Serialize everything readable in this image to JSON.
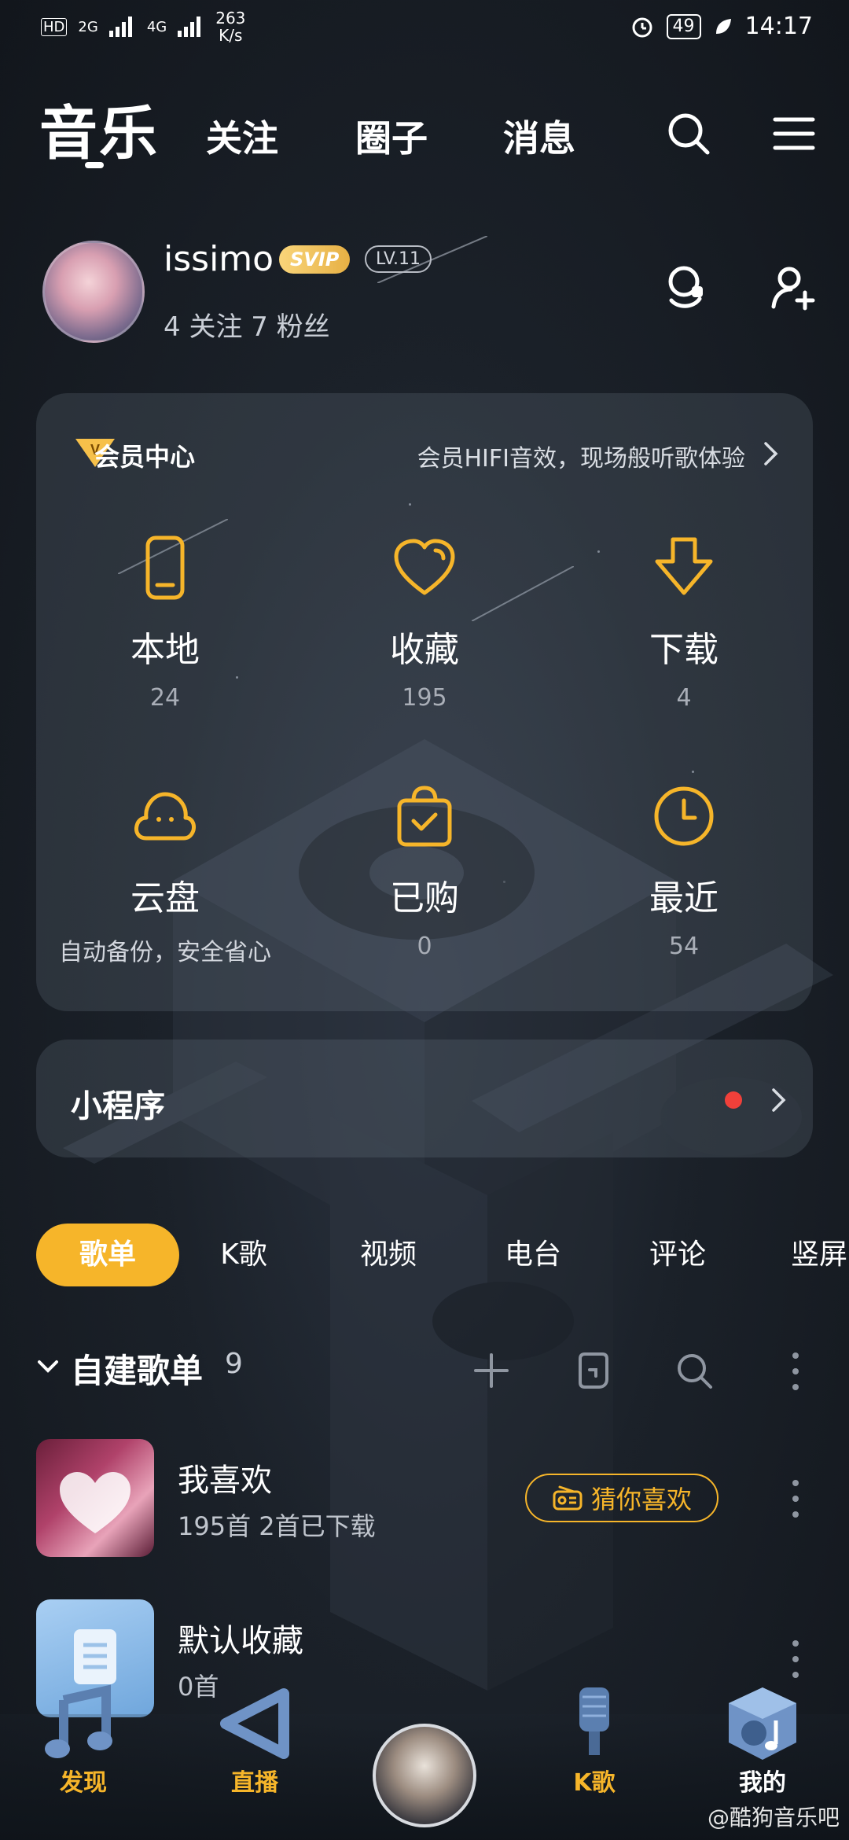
{
  "status_bar": {
    "network_badge": "HD",
    "signal_1": "2G",
    "signal_2": "4G",
    "speed_value": "263",
    "speed_unit": "K/s",
    "battery": "49",
    "time": "14:17"
  },
  "top_nav": {
    "brand": "音乐",
    "tabs": [
      "关注",
      "圈子",
      "消息"
    ]
  },
  "profile": {
    "username": "issimo",
    "svip_badge": "SVIP",
    "level_badge": "LV.11",
    "follow_stats": "4 关注   7 粉丝"
  },
  "vip_card": {
    "title": "会员中心",
    "description": "会员HIFI音效，现场般听歌体验",
    "items": [
      {
        "label": "本地",
        "count": "24",
        "icon": "phone-icon"
      },
      {
        "label": "收藏",
        "count": "195",
        "icon": "heart-icon"
      },
      {
        "label": "下载",
        "count": "4",
        "icon": "download-icon"
      },
      {
        "label": "云盘",
        "count": "自动备份，安全省心",
        "icon": "cloud-icon"
      },
      {
        "label": "已购",
        "count": "0",
        "icon": "shopping-bag-icon"
      },
      {
        "label": "最近",
        "count": "54",
        "icon": "clock-icon"
      }
    ]
  },
  "mini_program": {
    "title": "小程序"
  },
  "content_tabs": [
    "歌单",
    "K歌",
    "视频",
    "电台",
    "评论",
    "竖屏"
  ],
  "playlist_section": {
    "title": "自建歌单",
    "count": "9",
    "playlists": [
      {
        "name": "我喜欢",
        "sub": "195首    2首已下载",
        "action": "猜你喜欢"
      },
      {
        "name": "默认收藏",
        "sub": "0首"
      }
    ]
  },
  "bottom_nav": {
    "items": [
      "发现",
      "直播",
      "K歌",
      "我的"
    ]
  },
  "watermark": "@酷狗音乐吧",
  "colors": {
    "accent": "#f6b52a",
    "background": "#1b2129",
    "notification_dot": "#f0403a"
  }
}
